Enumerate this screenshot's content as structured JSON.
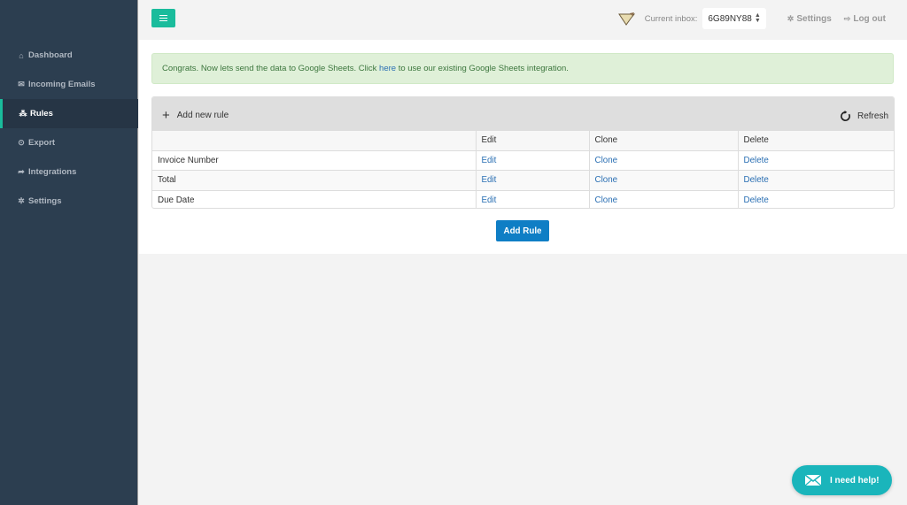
{
  "sidebar": {
    "items": [
      {
        "label": "Dashboard",
        "icon": "home-icon",
        "glyph": "⌂",
        "active": false
      },
      {
        "label": "Incoming Emails",
        "icon": "envelope-icon",
        "glyph": "✉",
        "active": false
      },
      {
        "label": "Rules",
        "icon": "sitemap-icon",
        "glyph": "⁂",
        "active": true
      },
      {
        "label": "Export",
        "icon": "circle-dot-icon",
        "glyph": "⊙",
        "active": false
      },
      {
        "label": "Integrations",
        "icon": "share-arrow-icon",
        "glyph": "➦",
        "active": false
      },
      {
        "label": "Settings",
        "icon": "gear-icon",
        "glyph": "✲",
        "active": false
      }
    ]
  },
  "topbar": {
    "current_inbox_label": "Current inbox:",
    "inbox_value": "6G89NY88",
    "settings_label": "Settings",
    "logout_label": "Log out"
  },
  "alert": {
    "text_before": "Congrats. Now lets send the data to Google Sheets. Click ",
    "link": "here",
    "text_after": " to use our existing Google Sheets integration."
  },
  "panel": {
    "add_new_rule": "Add new rule",
    "refresh": "Refresh",
    "header": [
      "",
      "Edit",
      "Clone",
      "Delete"
    ],
    "rows": [
      {
        "name": "Invoice Number",
        "edit": "Edit",
        "clone": "Clone",
        "delete": "Delete"
      },
      {
        "name": "Total",
        "edit": "Edit",
        "clone": "Clone",
        "delete": "Delete"
      },
      {
        "name": "Due Date",
        "edit": "Edit",
        "clone": "Clone",
        "delete": "Delete"
      }
    ]
  },
  "add_rule_button": "Add Rule",
  "help_button": "I need help!",
  "colors": {
    "accent": "#1abc9c",
    "sidebar": "#2c3e50",
    "primary_button": "#0f7ec5",
    "help": "#1ab5bb",
    "link": "#2a6fb3"
  }
}
